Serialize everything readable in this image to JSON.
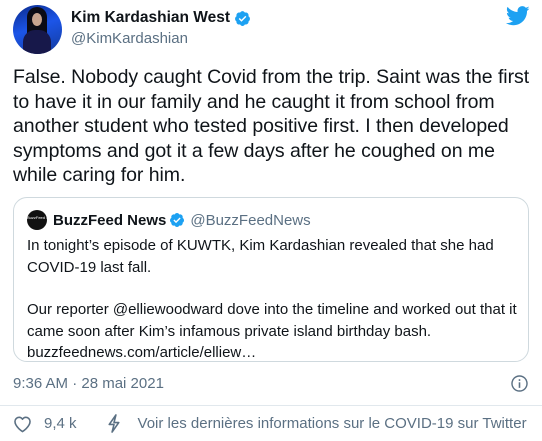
{
  "author": {
    "display_name": "Kim Kardashian West",
    "handle": "@KimKardashian",
    "avatar_icon": "profile-photo",
    "verified_icon": "verified-badge-icon"
  },
  "brand": {
    "icon": "twitter-bird-icon",
    "color": "#1da1f2"
  },
  "tweet": {
    "text": "False. Nobody caught Covid from the trip. Saint was the first to have it in our family and he caught it from school from another student who tested positive first. I then developed symptoms and got it a few days after he coughed on me while caring for him."
  },
  "quoted_tweet": {
    "display_name": "BuzzFeed News",
    "handle": "@BuzzFeedNews",
    "avatar_icon": "buzzfeed-news-logo",
    "paragraph_1": "In tonight’s episode of KUWTK, Kim Kardashian revealed that she had COVID-19 last fall.",
    "paragraph_2": "Our reporter @elliewoodward dove into the timeline and worked out that it came soon after Kim’s infamous private island birthday bash.",
    "link": "buzzfeednews.com/article/elliew…"
  },
  "meta": {
    "timestamp": "9:36 AM · 28 mai 2021",
    "info_icon": "info-icon"
  },
  "actions": {
    "like_count": "9,4 k",
    "covid_info_label": "Voir les dernières informations sur le COVID-19 sur Twitter"
  },
  "colors": {
    "text": "#0f1419",
    "secondary": "#5b7083",
    "verified": "#1da1f2",
    "border": "#cfd9de"
  }
}
